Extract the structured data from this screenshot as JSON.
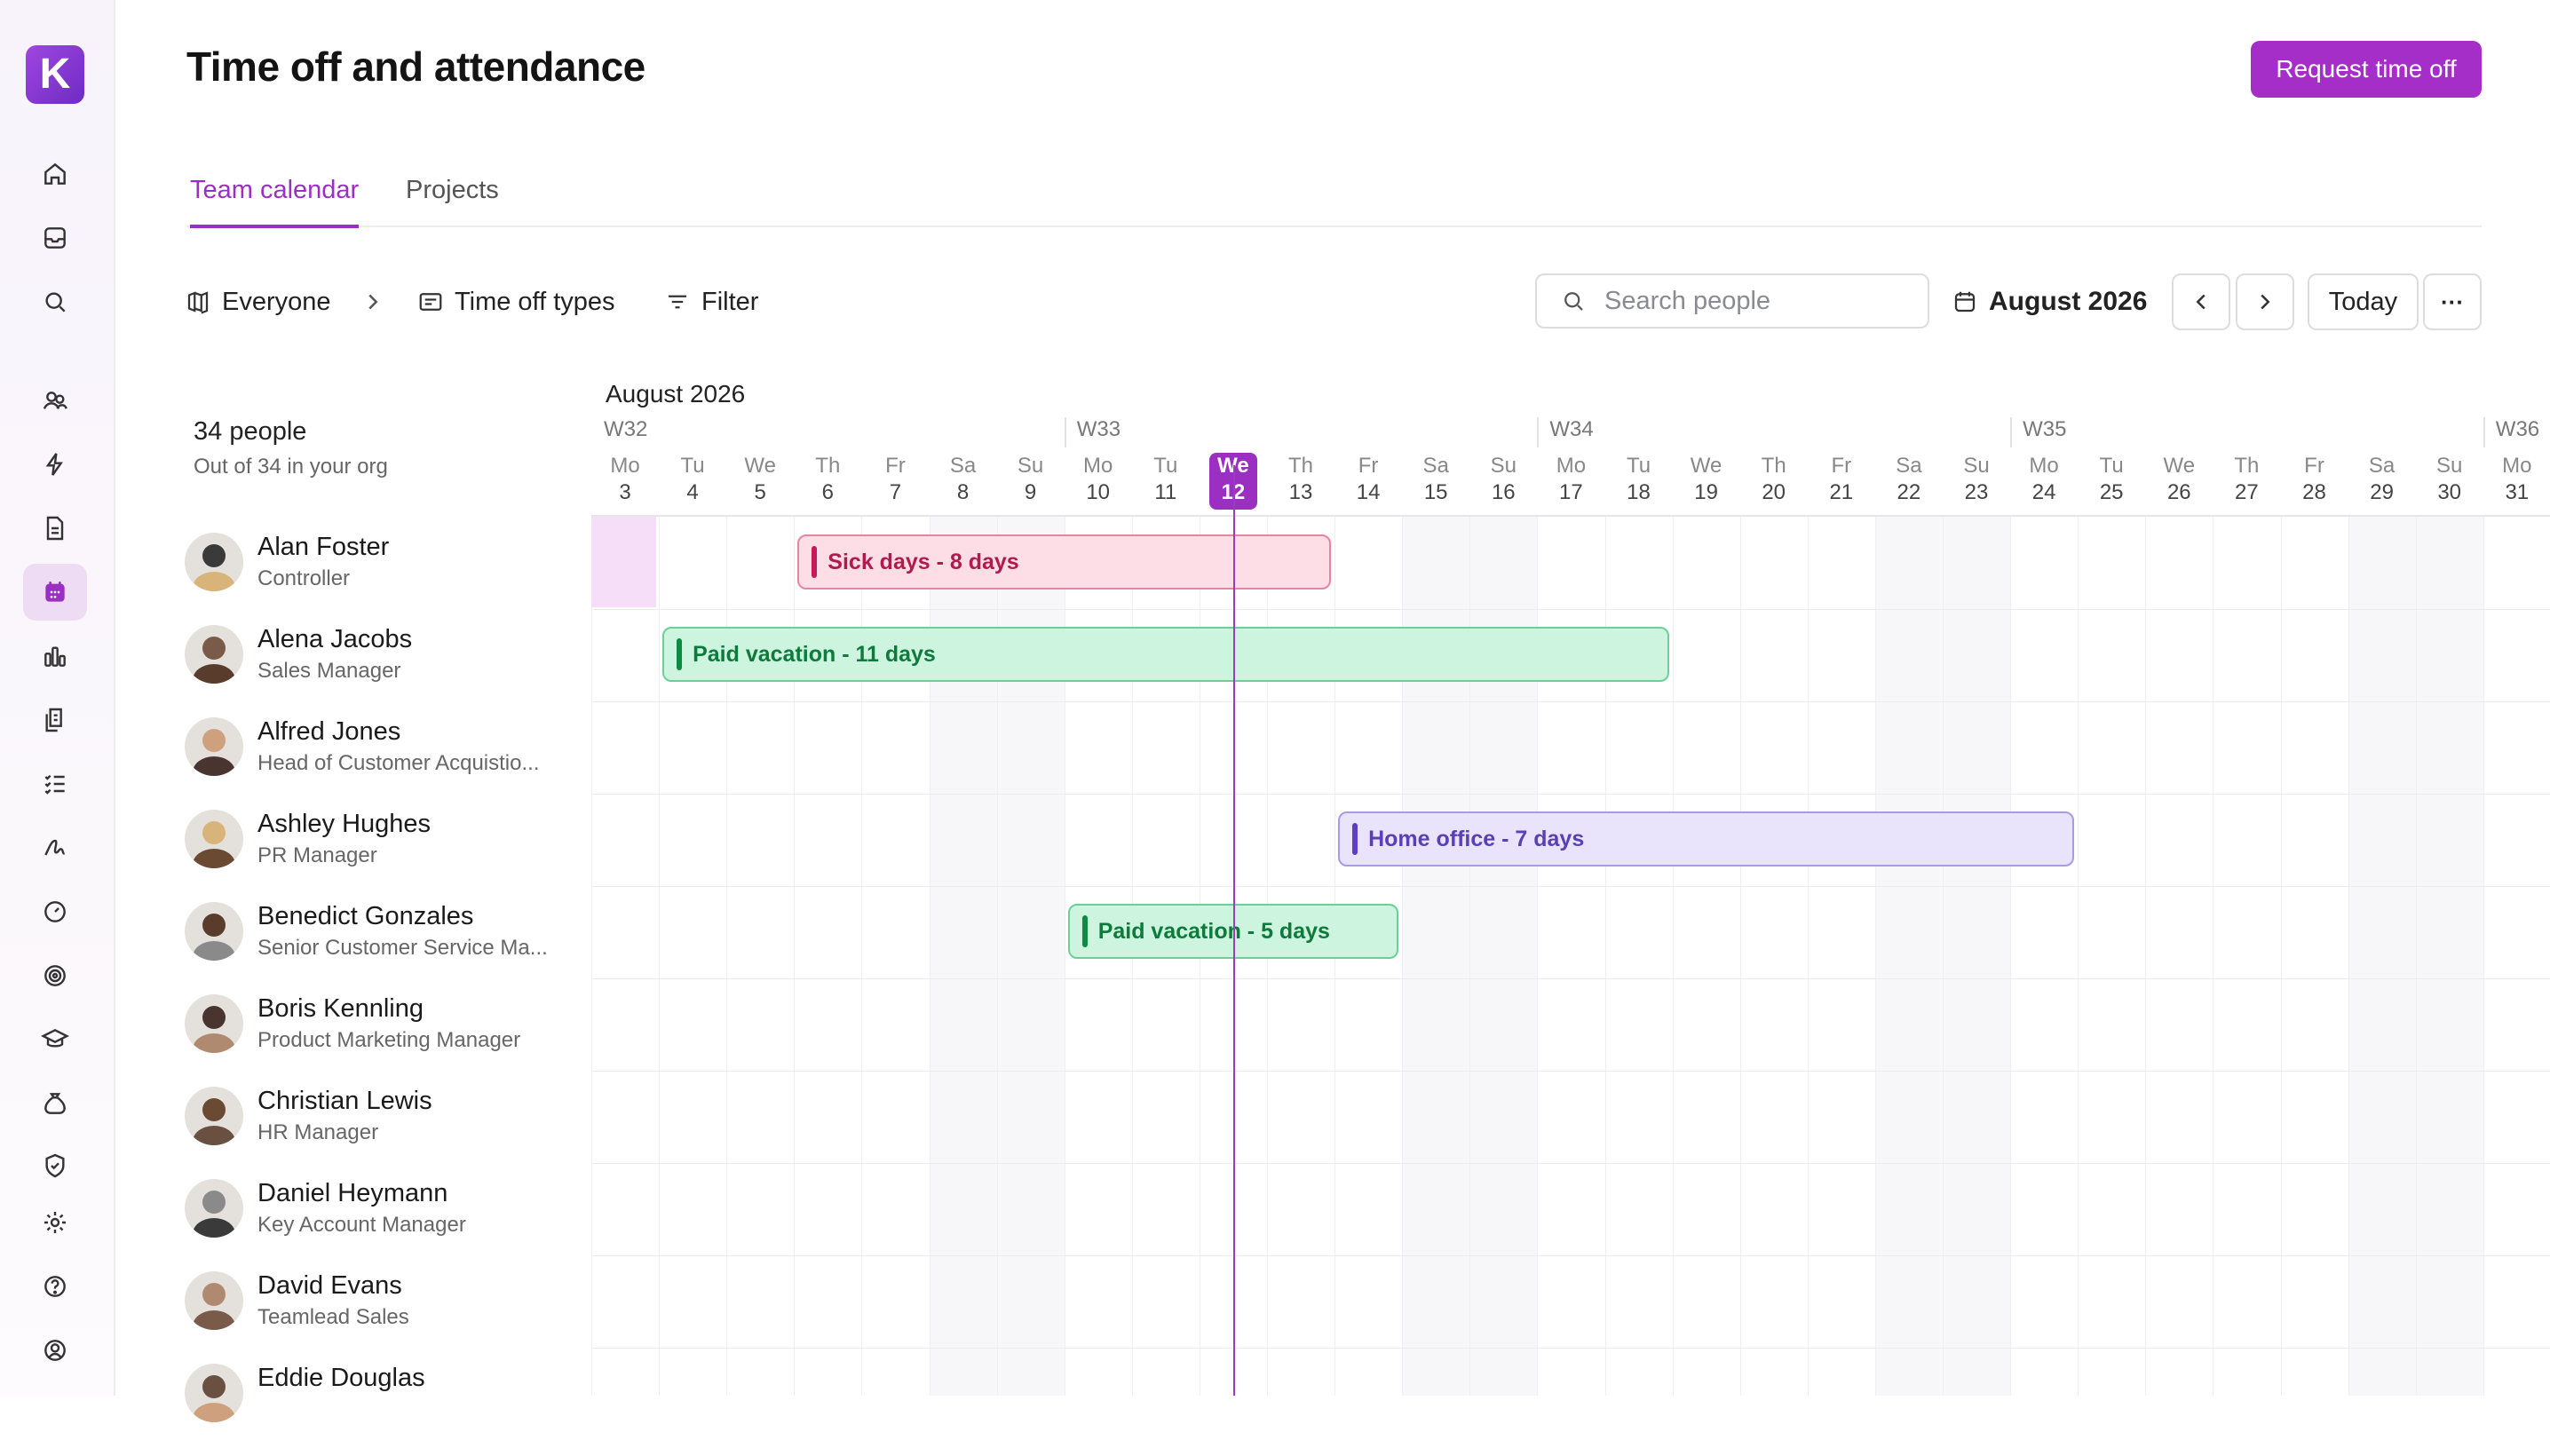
{
  "app": {
    "logo_letter": "K",
    "title": "Time off and attendance",
    "request_button": "Request time off"
  },
  "sidebar": {
    "items": [
      {
        "icon": "home-icon"
      },
      {
        "icon": "inbox-icon"
      },
      {
        "icon": "search-icon"
      },
      {
        "icon": "people-icon"
      },
      {
        "icon": "lightning-icon"
      },
      {
        "icon": "document-icon"
      },
      {
        "icon": "calendar-icon",
        "active": true
      },
      {
        "icon": "bar-chart-icon"
      },
      {
        "icon": "files-icon"
      },
      {
        "icon": "checklist-icon"
      },
      {
        "icon": "signature-icon"
      },
      {
        "icon": "gauge-icon"
      },
      {
        "icon": "target-icon"
      },
      {
        "icon": "graduation-cap-icon"
      },
      {
        "icon": "money-bag-icon"
      },
      {
        "icon": "shield-check-icon"
      },
      {
        "icon": "gear-icon"
      },
      {
        "icon": "help-icon"
      },
      {
        "icon": "account-icon"
      }
    ]
  },
  "tabs": [
    {
      "label": "Team calendar",
      "active": true
    },
    {
      "label": "Projects",
      "active": false
    }
  ],
  "toolbar": {
    "everyone": "Everyone",
    "time_off_types": "Time off types",
    "filter": "Filter",
    "search_placeholder": "Search people",
    "month": "August 2026",
    "today": "Today",
    "more": "···"
  },
  "people_summary": {
    "count": "34 people",
    "subtitle": "Out of 34 in your org"
  },
  "people": [
    {
      "name": "Alan Foster",
      "role": "Controller"
    },
    {
      "name": "Alena Jacobs",
      "role": "Sales Manager"
    },
    {
      "name": "Alfred Jones",
      "role": "Head of Customer Acquistio..."
    },
    {
      "name": "Ashley Hughes",
      "role": "PR Manager"
    },
    {
      "name": "Benedict Gonzales",
      "role": "Senior Customer Service Ma..."
    },
    {
      "name": "Boris Kennling",
      "role": "Product Marketing Manager"
    },
    {
      "name": "Christian Lewis",
      "role": "HR Manager"
    },
    {
      "name": "Daniel Heymann",
      "role": "Key Account Manager"
    },
    {
      "name": "David Evans",
      "role": "Teamlead Sales"
    },
    {
      "name": "Eddie Douglas",
      "role": ""
    }
  ],
  "calendar": {
    "month_label": "August 2026",
    "weeks": [
      {
        "label": "W32",
        "start_index": 0
      },
      {
        "label": "W33",
        "start_index": 7
      },
      {
        "label": "W34",
        "start_index": 14
      },
      {
        "label": "W35",
        "start_index": 21
      },
      {
        "label": "W36",
        "start_index": 28
      }
    ],
    "days": [
      {
        "dow": "Mo",
        "num": "3"
      },
      {
        "dow": "Tu",
        "num": "4"
      },
      {
        "dow": "We",
        "num": "5"
      },
      {
        "dow": "Th",
        "num": "6"
      },
      {
        "dow": "Fr",
        "num": "7"
      },
      {
        "dow": "Sa",
        "num": "8"
      },
      {
        "dow": "Su",
        "num": "9"
      },
      {
        "dow": "Mo",
        "num": "10"
      },
      {
        "dow": "Tu",
        "num": "11"
      },
      {
        "dow": "We",
        "num": "12"
      },
      {
        "dow": "Th",
        "num": "13"
      },
      {
        "dow": "Fr",
        "num": "14"
      },
      {
        "dow": "Sa",
        "num": "15"
      },
      {
        "dow": "Su",
        "num": "16"
      },
      {
        "dow": "Mo",
        "num": "17"
      },
      {
        "dow": "Tu",
        "num": "18"
      },
      {
        "dow": "We",
        "num": "19"
      },
      {
        "dow": "Th",
        "num": "20"
      },
      {
        "dow": "Fr",
        "num": "21"
      },
      {
        "dow": "Sa",
        "num": "22"
      },
      {
        "dow": "Su",
        "num": "23"
      },
      {
        "dow": "Mo",
        "num": "24"
      },
      {
        "dow": "Tu",
        "num": "25"
      },
      {
        "dow": "We",
        "num": "26"
      },
      {
        "dow": "Th",
        "num": "27"
      },
      {
        "dow": "Fr",
        "num": "28"
      },
      {
        "dow": "Sa",
        "num": "29"
      },
      {
        "dow": "Su",
        "num": "30"
      },
      {
        "dow": "Mo",
        "num": "31"
      }
    ],
    "today_index": 9,
    "events": [
      {
        "person_index": 0,
        "label": "Sick days - 8 days",
        "type": "sick",
        "start_date": "Aug 6",
        "end_date": "Aug 13"
      },
      {
        "person_index": 1,
        "label": "Paid vacation - 11 days",
        "type": "vacation",
        "start_date": "Aug 4",
        "end_date": "Aug 18"
      },
      {
        "person_index": 3,
        "label": "Home office - 7 days",
        "type": "home",
        "start_date": "Aug 14",
        "end_date": "Aug 24"
      },
      {
        "person_index": 4,
        "label": "Paid vacation - 5 days",
        "type": "vacation",
        "start_date": "Aug 10",
        "end_date": "Aug 14"
      }
    ]
  },
  "colors": {
    "accent": "#9b2fc2",
    "sick": "#c51958",
    "vacation": "#0e8a42",
    "home_office": "#5b3ec4"
  }
}
